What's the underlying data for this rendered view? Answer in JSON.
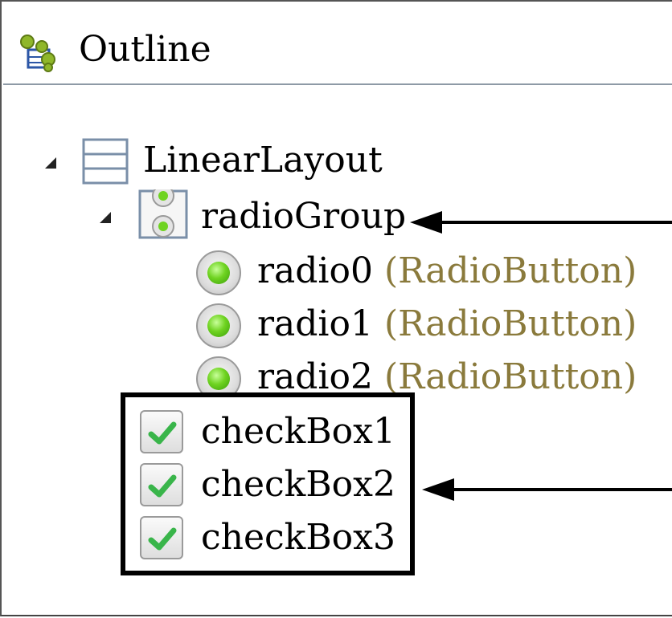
{
  "panel": {
    "title": "Outline",
    "icon": "outline-icon"
  },
  "tree": {
    "root": {
      "label": "LinearLayout",
      "icon": "linear-layout-icon",
      "expanded": true
    },
    "radio_group": {
      "label": "radioGroup",
      "icon": "radio-group-icon",
      "expanded": true,
      "children": [
        {
          "label": "radio0",
          "type": "(RadioButton)",
          "icon": "radio-button-icon"
        },
        {
          "label": "radio1",
          "type": "(RadioButton)",
          "icon": "radio-button-icon"
        },
        {
          "label": "radio2",
          "type": "(RadioButton)",
          "icon": "radio-button-icon"
        }
      ]
    },
    "checkboxes": [
      {
        "label": "checkBox1",
        "icon": "checkbox-icon"
      },
      {
        "label": "checkBox2",
        "icon": "checkbox-icon"
      },
      {
        "label": "checkBox3",
        "icon": "checkbox-icon"
      }
    ]
  },
  "colors": {
    "type_text": "#8a7a3c",
    "radio_green": "#6fd321",
    "check_green": "#39b54a",
    "separator": "#8e9aa6"
  }
}
